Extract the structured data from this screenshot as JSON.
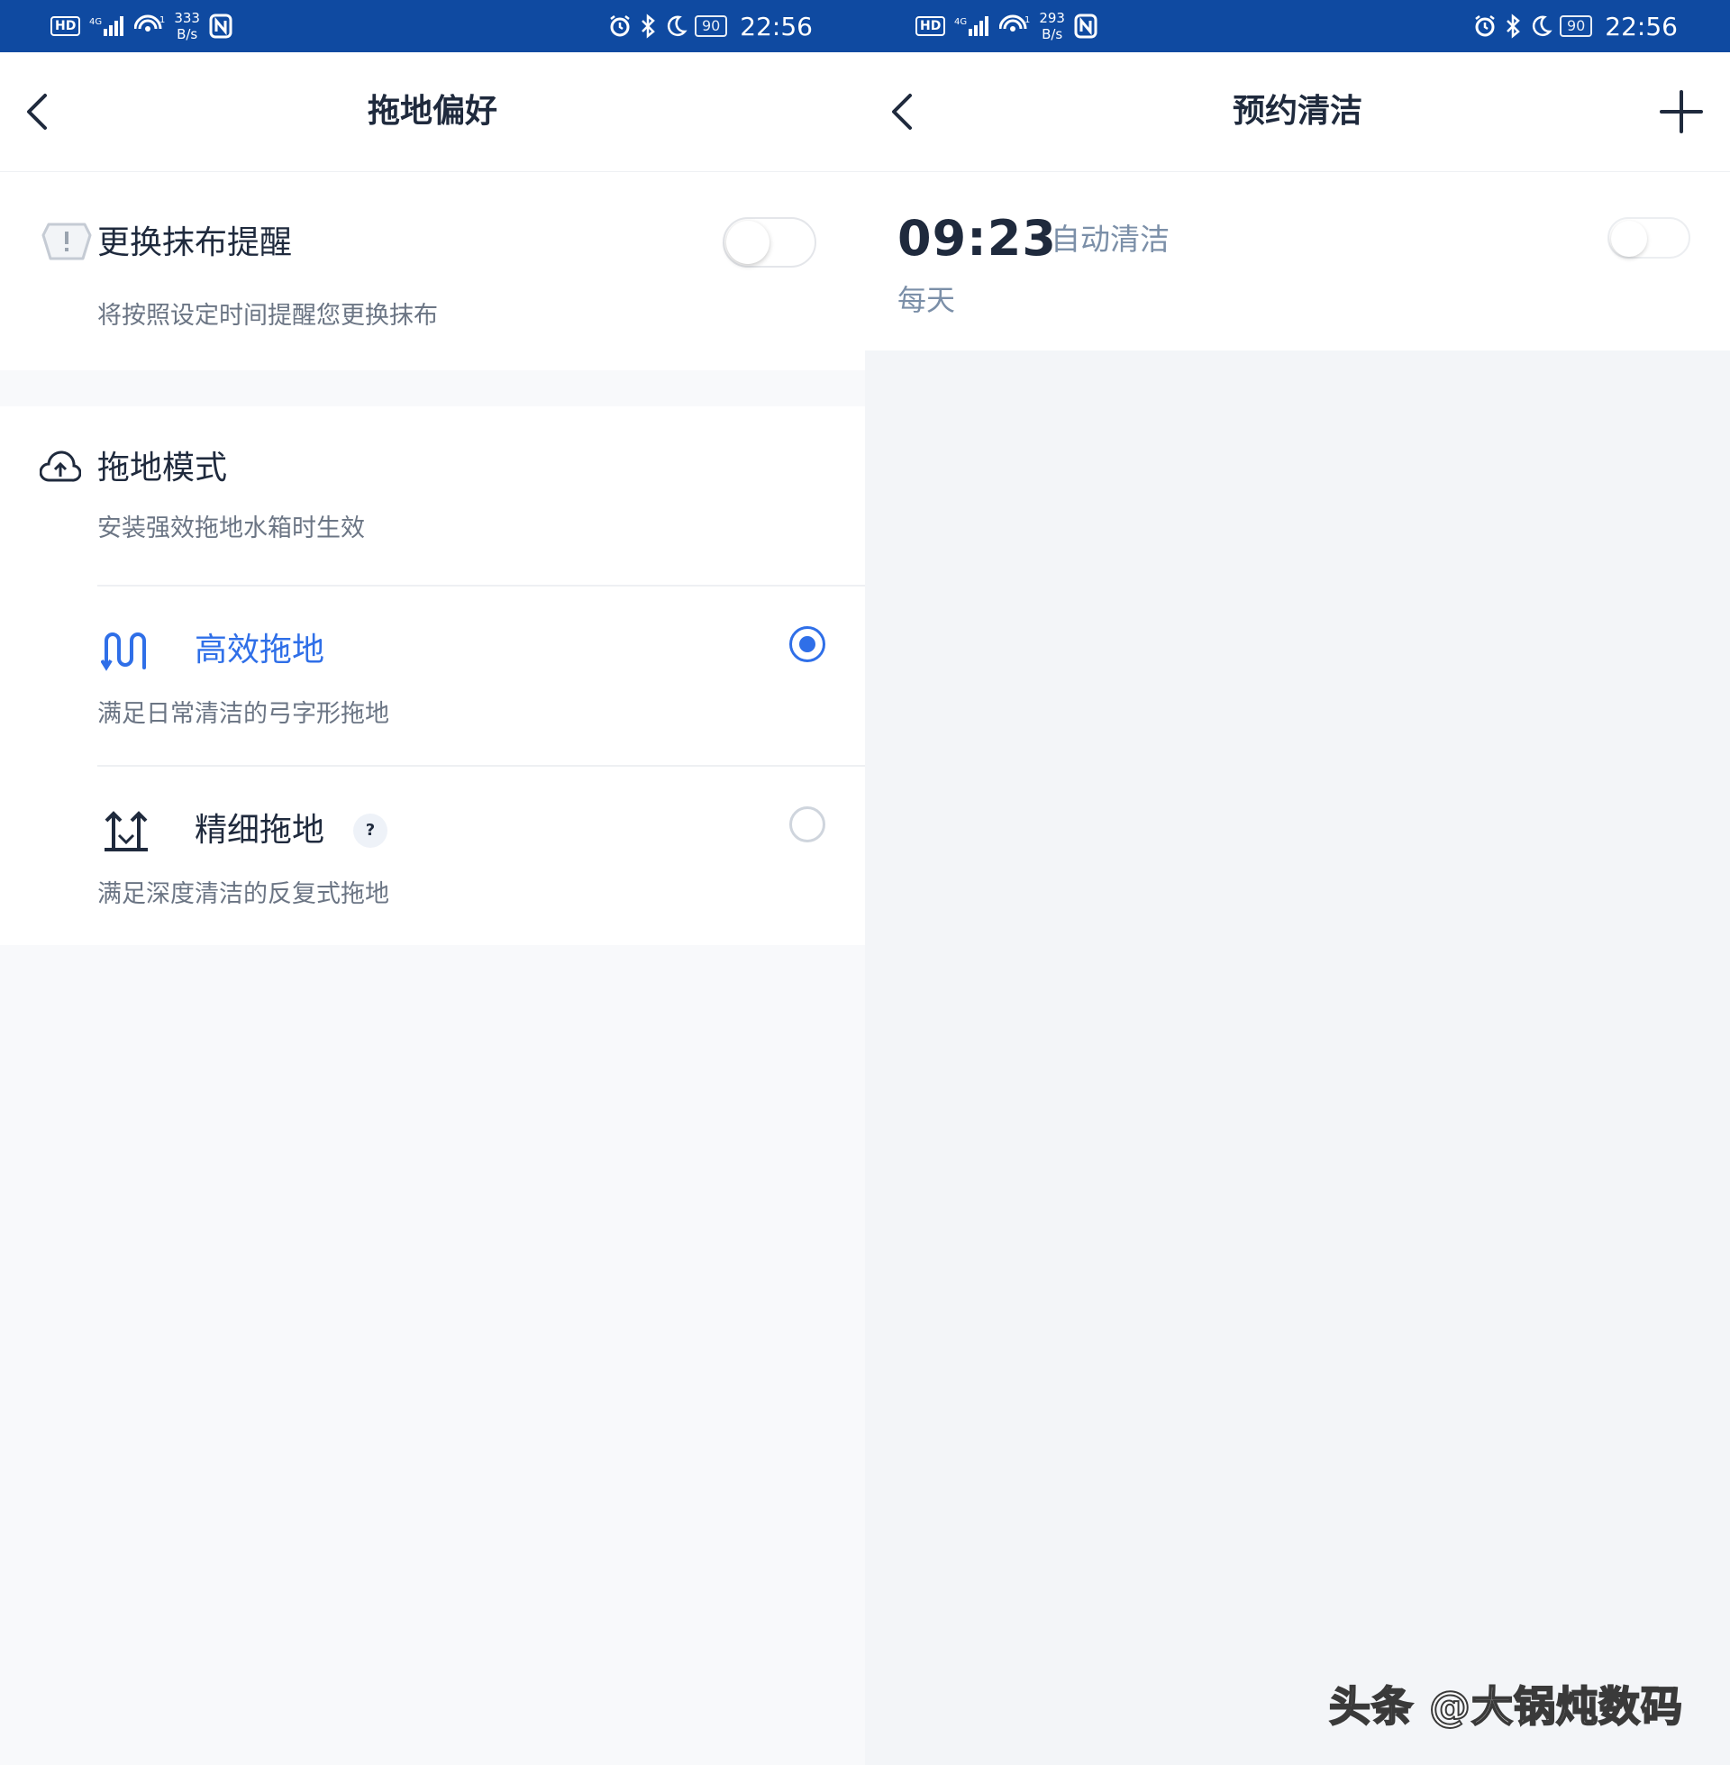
{
  "left": {
    "status": {
      "hd": "HD",
      "speed_value": "333",
      "speed_unit": "B/s",
      "battery": "90",
      "time": "22:56"
    },
    "nav": {
      "title": "拖地偏好"
    },
    "reminder": {
      "title": "更换抹布提醒",
      "subtitle": "将按照设定时间提醒您更换抹布",
      "enabled": false
    },
    "mode": {
      "title": "拖地模式",
      "subtitle": "安装强效拖地水箱时生效",
      "options": [
        {
          "label": "高效拖地",
          "desc": "满足日常清洁的弓字形拖地",
          "selected": true
        },
        {
          "label": "精细拖地",
          "desc": "满足深度清洁的反复式拖地",
          "selected": false,
          "help": "?"
        }
      ]
    }
  },
  "right": {
    "status": {
      "hd": "HD",
      "speed_value": "293",
      "speed_unit": "B/s",
      "battery": "90",
      "time": "22:56"
    },
    "nav": {
      "title": "预约清洁"
    },
    "schedule": {
      "time": "09:23",
      "task": "自动清洁",
      "repeat": "每天",
      "enabled": false
    }
  },
  "watermark": "头条 @大锅炖数码",
  "colors": {
    "statusbar": "#0f4aa1",
    "accent": "#2f6fe8",
    "title_text": "#1f2a3d",
    "secondary_text": "#6b7584"
  },
  "icons": [
    "back-chevron-icon",
    "add-icon",
    "mop-reminder-icon",
    "mop-mode-icon",
    "efficient-mop-icon",
    "fine-mop-icon",
    "signal-icon",
    "wifi-icon",
    "nfc-icon",
    "alarm-icon",
    "bluetooth-icon",
    "moon-icon",
    "battery-icon"
  ]
}
